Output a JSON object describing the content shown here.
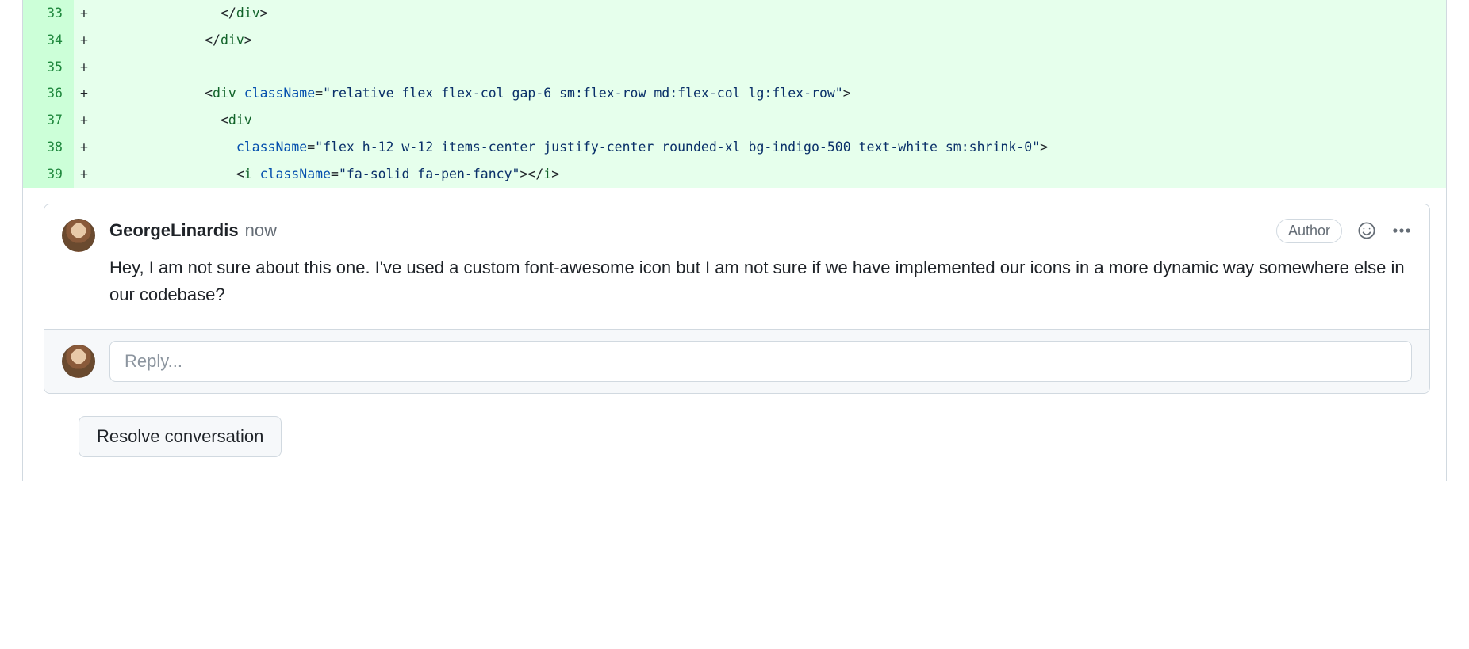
{
  "diff": {
    "lines": [
      {
        "num": "33",
        "marker": "+",
        "indent": "                ",
        "segments": [
          {
            "cls": "tag-punct",
            "t": "</"
          },
          {
            "cls": "tag-name",
            "t": "div"
          },
          {
            "cls": "tag-punct",
            "t": ">"
          }
        ]
      },
      {
        "num": "34",
        "marker": "+",
        "indent": "              ",
        "segments": [
          {
            "cls": "tag-punct",
            "t": "</"
          },
          {
            "cls": "tag-name",
            "t": "div"
          },
          {
            "cls": "tag-punct",
            "t": ">"
          }
        ]
      },
      {
        "num": "35",
        "marker": "+",
        "indent": "",
        "segments": []
      },
      {
        "num": "36",
        "marker": "+",
        "indent": "              ",
        "segments": [
          {
            "cls": "tag-punct",
            "t": "<"
          },
          {
            "cls": "tag-name",
            "t": "div"
          },
          {
            "cls": "",
            "t": " "
          },
          {
            "cls": "attr-name",
            "t": "className"
          },
          {
            "cls": "attr-punct",
            "t": "="
          },
          {
            "cls": "string",
            "t": "\"relative flex flex-col gap-6 sm:flex-row md:flex-col lg:flex-row\""
          },
          {
            "cls": "tag-punct",
            "t": ">"
          }
        ]
      },
      {
        "num": "37",
        "marker": "+",
        "indent": "                ",
        "segments": [
          {
            "cls": "tag-punct",
            "t": "<"
          },
          {
            "cls": "tag-name",
            "t": "div"
          }
        ]
      },
      {
        "num": "38",
        "marker": "+",
        "indent": "                  ",
        "segments": [
          {
            "cls": "attr-name",
            "t": "className"
          },
          {
            "cls": "attr-punct",
            "t": "="
          },
          {
            "cls": "string",
            "t": "\"flex h-12 w-12 items-center justify-center rounded-xl bg-indigo-500 text-white sm:shrink-0\""
          },
          {
            "cls": "tag-punct",
            "t": ">"
          }
        ]
      },
      {
        "num": "39",
        "marker": "+",
        "indent": "                  ",
        "segments": [
          {
            "cls": "tag-punct",
            "t": "<"
          },
          {
            "cls": "tag-name",
            "t": "i"
          },
          {
            "cls": "",
            "t": " "
          },
          {
            "cls": "attr-name",
            "t": "className"
          },
          {
            "cls": "attr-punct",
            "t": "="
          },
          {
            "cls": "string",
            "t": "\"fa-solid fa-pen-fancy\""
          },
          {
            "cls": "tag-punct",
            "t": ">"
          },
          {
            "cls": "tag-punct",
            "t": "</"
          },
          {
            "cls": "tag-name",
            "t": "i"
          },
          {
            "cls": "tag-punct",
            "t": ">"
          }
        ]
      }
    ]
  },
  "comment": {
    "author": "GeorgeLinardis",
    "time": "now",
    "badge": "Author",
    "body": "Hey, I am not sure about this one. I've used a custom font-awesome icon but I am not sure if we have implemented our icons in a more dynamic way somewhere else in our codebase?"
  },
  "reply": {
    "placeholder": "Reply..."
  },
  "resolve": {
    "label": "Resolve conversation"
  }
}
